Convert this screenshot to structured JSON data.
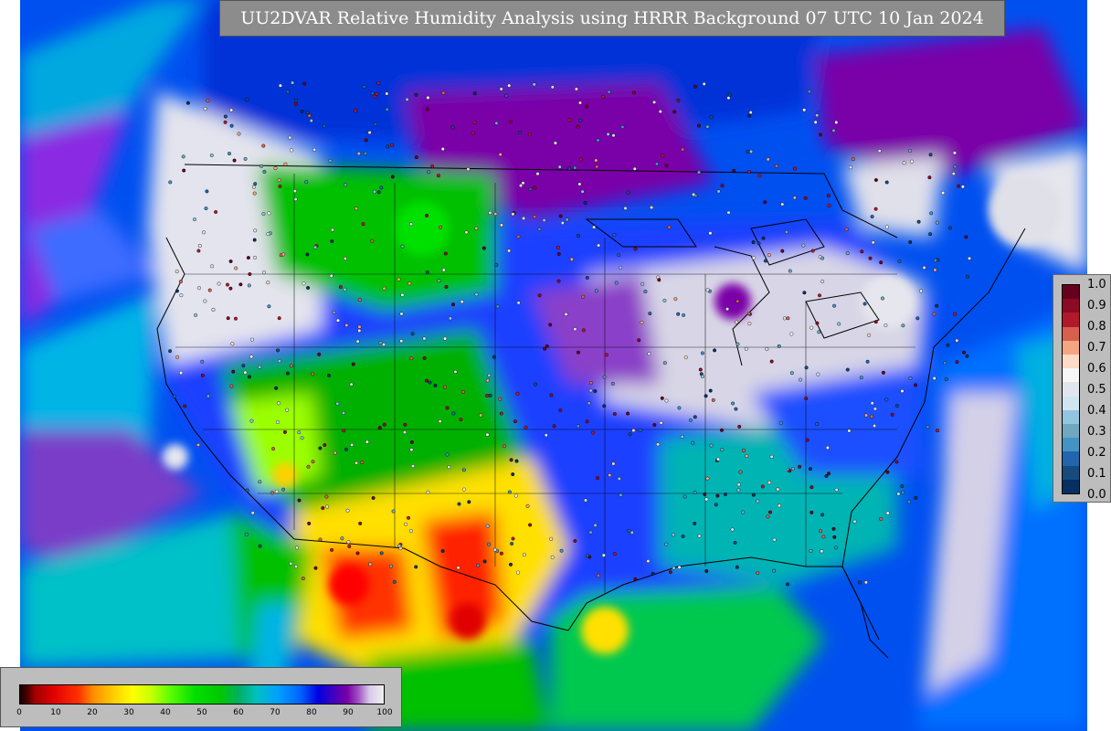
{
  "title": "UU2DVAR Relative Humidity Analysis using HRRR Background 07 UTC 10 Jan 2024",
  "observation_legend": {
    "ticks": [
      "1.0",
      "0.9",
      "0.8",
      "0.7",
      "0.6",
      "0.5",
      "0.4",
      "0.3",
      "0.2",
      "0.1",
      "0.0"
    ],
    "colors": [
      "#67001f",
      "#8b0a24",
      "#b2182b",
      "#d6604d",
      "#f4a582",
      "#fddbc7",
      "#f7f7f7",
      "#e0e6ee",
      "#d1e5f0",
      "#92c5de",
      "#6fa8c0",
      "#4393c3",
      "#2166ac",
      "#174a7e",
      "#053061"
    ]
  },
  "analysis_legend": {
    "ticks": [
      "0",
      "10",
      "20",
      "30",
      "40",
      "50",
      "60",
      "70",
      "80",
      "90",
      "100"
    ]
  },
  "colors": {
    "ocean_blue": "#0064ff",
    "ocean_cyan": "#00b4e6",
    "dry_red": "#e00000",
    "dry_yellow": "#ffe000",
    "moist_green": "#00c800",
    "humid_purple": "#7a00a8",
    "saturated_white": "#e8e8ee",
    "title_bg": "#8c8c8c",
    "legend_bg": "#bdbdbd"
  }
}
